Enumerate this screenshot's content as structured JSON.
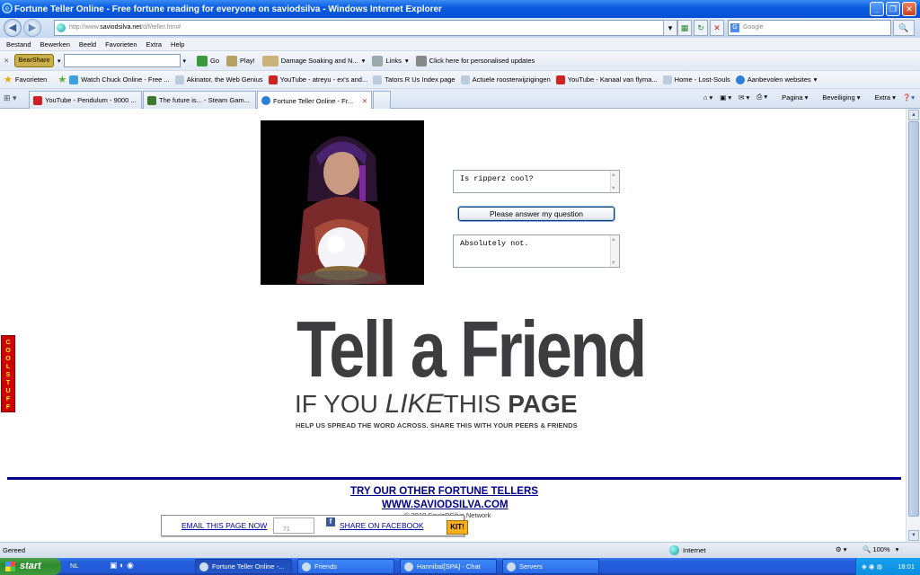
{
  "window": {
    "title": "Fortune Teller Online - Free fortune reading for everyone on saviodsilva - Windows Internet Explorer"
  },
  "address": {
    "url_prefix": "http://www.",
    "url_domain": "saviodsilva.net",
    "url_path": "/d/f/teller.htm#",
    "search_placeholder": "Google"
  },
  "menu": [
    "Bestand",
    "Bewerken",
    "Beeld",
    "Favorieten",
    "Extra",
    "Help"
  ],
  "toolbar": {
    "logo": "BearShare",
    "go": "Go",
    "play": "Play!",
    "damage": "Damage Soaking and N...",
    "links": "Links",
    "updates": "Click here for personalised updates"
  },
  "favorites": {
    "label": "Favorieten",
    "items": [
      "Watch Chuck Online - Free ...",
      "Akinator, the Web Genius",
      "YouTube - atreyu - ex's and...",
      "Tators R Us Index page",
      "Actuele roosterwijzigingen",
      "YouTube - Kanaal van flyma...",
      "Home - Lost-Souls",
      "Aanbevolen websites"
    ]
  },
  "tabs": [
    "YouTube - Pendulum - 9000 ...",
    "The future is... - Steam Gam...",
    "Fortune Teller Online - Fr..."
  ],
  "commands": {
    "page": "Pagina",
    "security": "Beveiliging",
    "extra": "Extra"
  },
  "fortune": {
    "question": "Is ripperz cool?",
    "button": "Please answer my question",
    "answer": "Absolutely not."
  },
  "sidetab": "COOL STUFF",
  "promo": {
    "headline": "Tell a Friend",
    "sub_if_you": "IF YOU",
    "sub_like": "LIKE",
    "sub_this": "THIS",
    "sub_page": "PAGE",
    "help": "HELP US SPREAD THE WORD ACROSS. SHARE THIS WITH YOUR PEERS & FRIENDS"
  },
  "links": {
    "other": "TRY OUR OTHER FORTUNE TELLERS",
    "site": "WWW.SAVIODSILVA.COM",
    "copyright": "© 2010 SavioDSilva Network"
  },
  "share": {
    "email": "EMAIL THIS PAGE NOW",
    "mini_value": "71",
    "facebook": "SHARE ON FACEBOOK",
    "kit": "KIT!"
  },
  "status": {
    "text": "Gereed",
    "zone": "Internet",
    "zoom": "100%"
  },
  "taskbar": {
    "start": "start",
    "lang": "NL",
    "tasks": [
      "Fortune Teller Online -...",
      "Friends",
      "Hannibal[SPA] - Chat",
      "Servers"
    ],
    "clock": "18:01"
  },
  "colors": {
    "link_blue": "#00008b",
    "promo_gray": "#3d3d3f",
    "titlebar_blue": "#0a5de0",
    "sidetab_red": "#cc0000"
  }
}
